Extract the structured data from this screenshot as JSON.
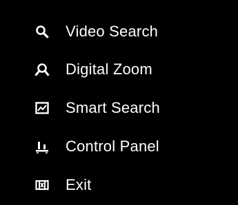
{
  "menu": {
    "items": [
      {
        "label": "Video Search",
        "icon": "search-icon"
      },
      {
        "label": "Digital Zoom",
        "icon": "zoom-icon"
      },
      {
        "label": "Smart Search",
        "icon": "smart-search-icon"
      },
      {
        "label": "Control Panel",
        "icon": "control-panel-icon"
      },
      {
        "label": "Exit",
        "icon": "exit-icon"
      }
    ]
  },
  "colors": {
    "background": "#000000",
    "text": "#ffffff",
    "icon": "#ffffff"
  }
}
